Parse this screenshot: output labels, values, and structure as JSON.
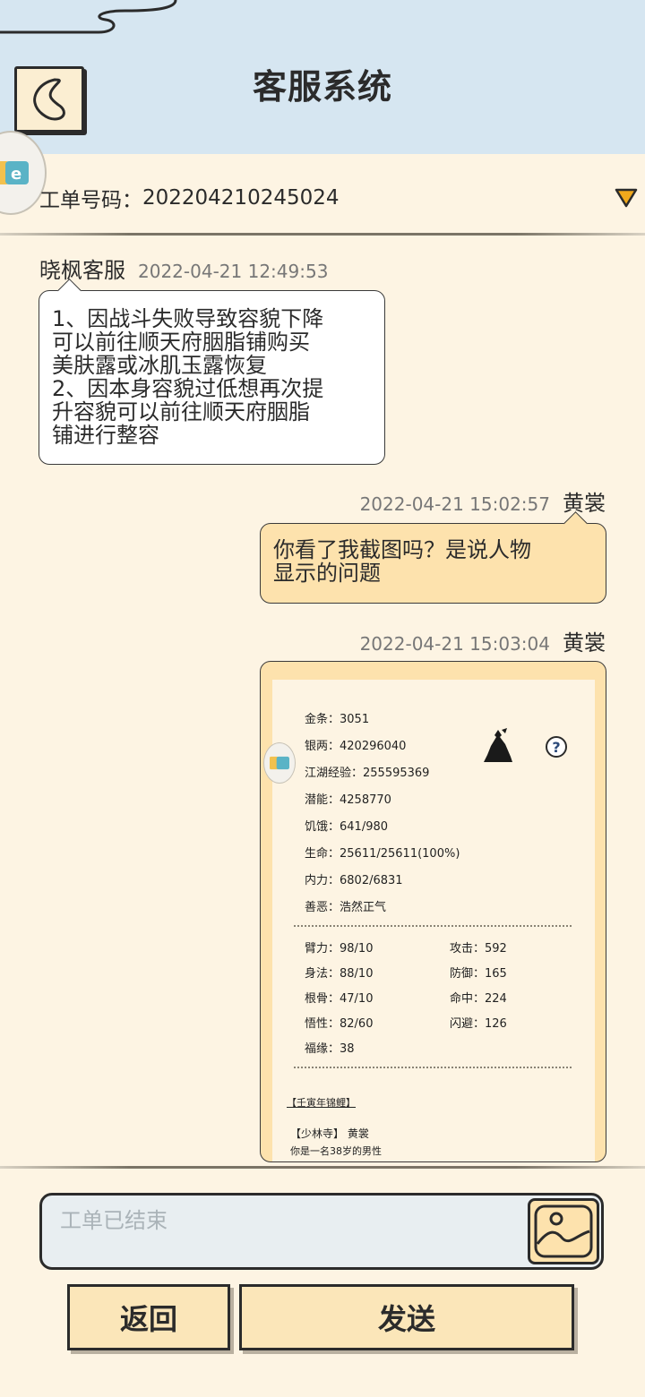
{
  "header": {
    "title": "客服系统"
  },
  "ticket": {
    "label": "工单号码：",
    "number": "202204210245024"
  },
  "messages": [
    {
      "sender": "晓枫客服",
      "time": "2022-04-21 12:49:53",
      "lines": [
        "1、因战斗失败导致容貌下降",
        "可以前往顺天府胭脂铺购买",
        "美肤露或冰肌玉露恢复",
        "2、因本身容貌过低想再次提",
        "升容貌可以前往顺天府胭脂",
        "铺进行整容"
      ]
    },
    {
      "sender": "黄裳",
      "time": "2022-04-21 15:02:57",
      "lines": [
        "你看了我截图吗？是说人物",
        "显示的问题"
      ]
    },
    {
      "sender": "黄裳",
      "time": "2022-04-21 15:03:04",
      "screenshot": {
        "stats": [
          "金条：3051",
          "银两：420296040",
          "江湖经验：255595369",
          "潜能：4258770",
          "饥饿：641/980",
          "生命：25611/25611(100%)",
          "内力：6802/6831",
          "善恶：浩然正气"
        ],
        "attrs_left": [
          "臂力：98/10",
          "身法：88/10",
          "根骨：47/10",
          "悟性：82/60",
          "福缘：38"
        ],
        "attrs_right": [
          "攻击：592",
          "防御：165",
          "命中：224",
          "闪避：126"
        ],
        "title_tag": "【壬寅年锦鲤】",
        "faction": "【少林寺】 黄裳",
        "bio": "你是一名38岁的男性"
      }
    }
  ],
  "input": {
    "placeholder": "工单已结束"
  },
  "buttons": {
    "return": "返回",
    "send": "发送"
  },
  "colors": {
    "header_bg": "#d6e6f1",
    "page_bg": "#fdf4e3",
    "user_bubble": "#fde2ad",
    "dropdown": "#f0a81c"
  }
}
